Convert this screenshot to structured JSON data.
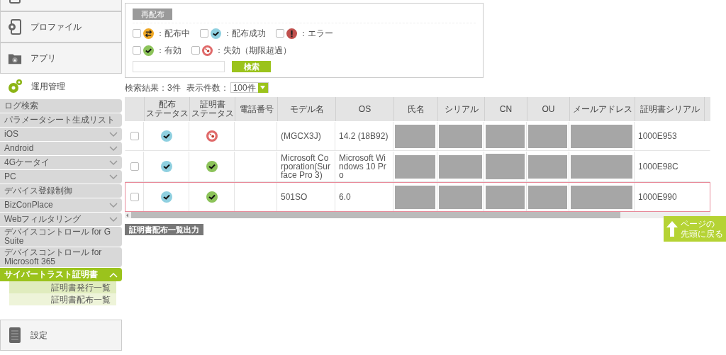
{
  "sidebar": {
    "top_items": [
      {
        "kind": "device"
      },
      {
        "kind": "profile",
        "label": "プロファイル"
      },
      {
        "kind": "app",
        "label": "アプリ"
      }
    ],
    "section": {
      "label": "運用管理"
    },
    "items": [
      {
        "label": "ログ検索",
        "expandable": false,
        "selected": false
      },
      {
        "label": "パラメータシート生成リスト",
        "expandable": false,
        "selected": false
      },
      {
        "label": "iOS",
        "expandable": true,
        "expanded": false,
        "selected": false
      },
      {
        "label": "Android",
        "expandable": true,
        "expanded": false,
        "selected": false
      },
      {
        "label": "4Gケータイ",
        "expandable": true,
        "expanded": false,
        "selected": false
      },
      {
        "label": "PC",
        "expandable": true,
        "expanded": false,
        "selected": false
      },
      {
        "label": "デバイス登録制御",
        "expandable": false,
        "selected": false
      },
      {
        "label": "BizConPlace",
        "expandable": true,
        "expanded": false,
        "selected": false
      },
      {
        "label": "Webフィルタリング",
        "expandable": true,
        "expanded": false,
        "selected": false
      },
      {
        "label": "デバイスコントロール for G Suite",
        "expandable": false,
        "selected": false
      },
      {
        "label": "デバイスコントロール for Microsoft 365",
        "expandable": false,
        "selected": false
      },
      {
        "label": "サイバートラスト証明書",
        "expandable": true,
        "expanded": true,
        "selected": true,
        "children": [
          {
            "label": "証明書発行一覧"
          },
          {
            "label": "証明書配布一覧"
          }
        ]
      }
    ],
    "bottom_items": [
      {
        "kind": "settings",
        "label": "設定"
      }
    ]
  },
  "filter": {
    "redistribute_button": "再配布",
    "checks": [
      {
        "kind": "delivering",
        "label": "：配布中",
        "checked": false
      },
      {
        "kind": "delivered",
        "label": "：配布成功",
        "checked": false
      },
      {
        "kind": "error",
        "label": "：エラー",
        "checked": false
      },
      {
        "kind": "valid",
        "label": "：有効",
        "checked": false
      },
      {
        "kind": "expired",
        "label": "：失効（期限超過）",
        "checked": false
      }
    ],
    "search_button": "検索"
  },
  "results": {
    "count": "検索結果：3件",
    "per_page_label": "表示件数：",
    "per_page": "100件"
  },
  "table": {
    "columns": [
      {
        "lines": [
          "配布",
          "ステータス"
        ]
      },
      {
        "lines": [
          "証明書",
          "ステータス"
        ]
      },
      {
        "lines": [
          "電話番号"
        ]
      },
      {
        "lines": [
          "モデル名"
        ]
      },
      {
        "lines": [
          "OS"
        ]
      },
      {
        "lines": [
          "氏名"
        ]
      },
      {
        "lines": [
          "シリアル"
        ]
      },
      {
        "lines": [
          "CN"
        ]
      },
      {
        "lines": [
          "OU"
        ]
      },
      {
        "lines": [
          "メールアドレス"
        ]
      },
      {
        "lines": [
          "証明書シリアル"
        ]
      }
    ],
    "rows": [
      {
        "checked": false,
        "selected": false,
        "dist_status": {
          "kind": "delivered"
        },
        "cert_status": {
          "kind": "expired"
        },
        "model": "(MGCX3J)",
        "os": "14.2 (18B92)",
        "redacted": true,
        "cert_serial": "1000E953"
      },
      {
        "checked": false,
        "selected": false,
        "dist_status": {
          "kind": "delivered"
        },
        "cert_status": {
          "kind": "valid"
        },
        "model": "Microsoft Corporation(Surface Pro 3)",
        "os": "Microsoft Windows 10 Pro",
        "redacted": true,
        "cert_serial": "1000E98C"
      },
      {
        "checked": false,
        "selected": true,
        "dist_status": {
          "kind": "delivered"
        },
        "cert_status": {
          "kind": "valid"
        },
        "model": "501SO",
        "os": "6.0",
        "redacted": true,
        "cert_serial": "1000E990"
      }
    ]
  },
  "export_button": "証明書配布一覧出力",
  "back_to_top": {
    "lines": [
      "ページの",
      "先頭に戻る"
    ]
  }
}
